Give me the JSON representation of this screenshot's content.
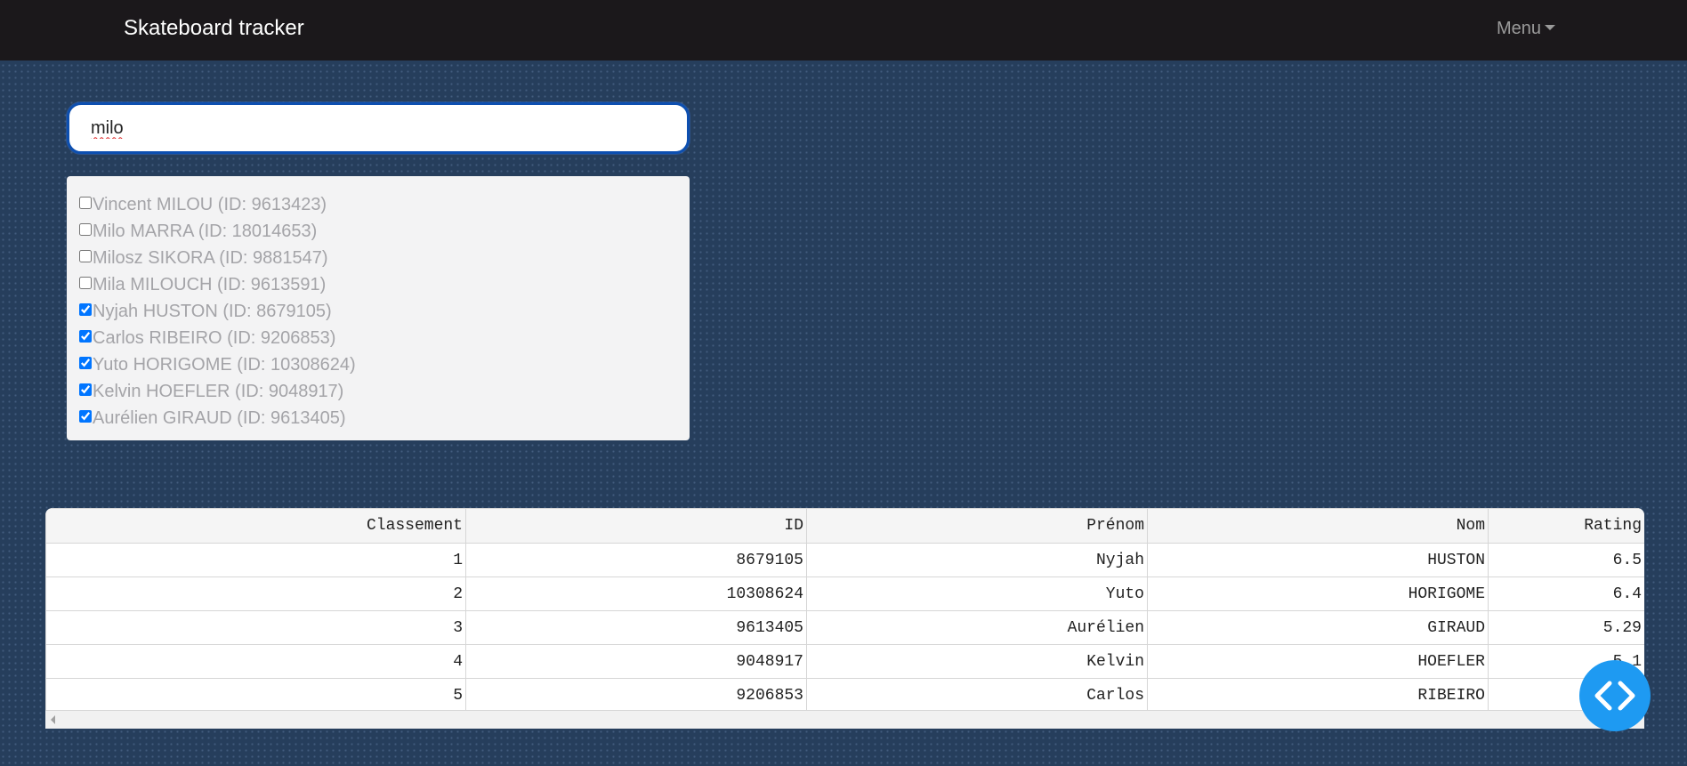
{
  "navbar": {
    "brand": "Skateboard tracker",
    "menu_label": "Menu"
  },
  "search": {
    "value": "milo"
  },
  "results": [
    {
      "label": "Vincent MILOU (ID: 9613423)",
      "checked": false
    },
    {
      "label": "Milo MARRA (ID: 18014653)",
      "checked": false
    },
    {
      "label": "Milosz SIKORA (ID: 9881547)",
      "checked": false
    },
    {
      "label": "Mila MILOUCH (ID: 9613591)",
      "checked": false
    },
    {
      "label": "Nyjah HUSTON (ID: 8679105)",
      "checked": true
    },
    {
      "label": "Carlos RIBEIRO (ID: 9206853)",
      "checked": true
    },
    {
      "label": "Yuto HORIGOME (ID: 10308624)",
      "checked": true
    },
    {
      "label": "Kelvin HOEFLER (ID: 9048917)",
      "checked": true
    },
    {
      "label": "Aurélien GIRAUD (ID: 9613405)",
      "checked": true
    }
  ],
  "table": {
    "headers": [
      "Classement",
      "ID",
      "Prénom",
      "Nom",
      "Rating"
    ],
    "rows": [
      [
        "1",
        "8679105",
        "Nyjah",
        "HUSTON",
        "6.5"
      ],
      [
        "2",
        "10308624",
        "Yuto",
        "HORIGOME",
        "6.4"
      ],
      [
        "3",
        "9613405",
        "Aurélien",
        "GIRAUD",
        "5.29"
      ],
      [
        "4",
        "9048917",
        "Kelvin",
        "HOEFLER",
        "5.1"
      ],
      [
        "5",
        "9206853",
        "Carlos",
        "RIBEIRO",
        ""
      ]
    ]
  },
  "fab": {
    "icon": "code-icon",
    "color": "#1e9af2"
  },
  "colors": {
    "navbar_bg": "#1b181b",
    "page_bg": "#263e5c",
    "focus_border": "#0d4fb0"
  }
}
